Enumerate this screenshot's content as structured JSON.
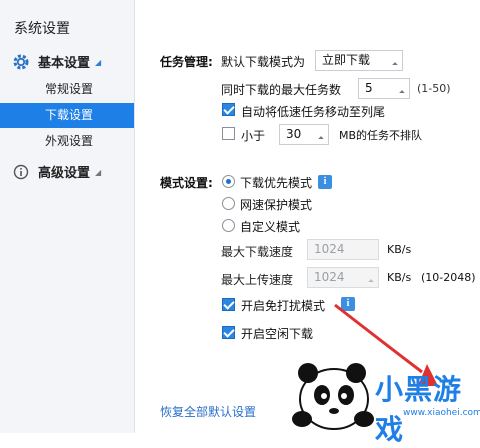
{
  "sidebar": {
    "title": "系统设置",
    "groups": [
      {
        "label": "基本设置",
        "icon": "gear-icon",
        "items": [
          {
            "label": "常规设置"
          },
          {
            "label": "下载设置",
            "active": true
          },
          {
            "label": "外观设置"
          }
        ]
      },
      {
        "label": "高级设置",
        "icon": "info-circle-icon"
      }
    ]
  },
  "task": {
    "section_label": "任务管理:",
    "default_mode_label": "默认下载模式为",
    "default_mode_value": "立即下载",
    "max_tasks_label": "同时下载的最大任务数",
    "max_tasks_value": "5",
    "max_tasks_range": "(1-50)",
    "auto_move_label": "自动将低速任务移动至列尾",
    "auto_move_checked": true,
    "less_than_label": "小于",
    "less_than_value": "30",
    "less_than_suffix": "MB的任务不排队",
    "less_than_checked": false
  },
  "mode": {
    "section_label": "模式设置:",
    "options": [
      {
        "label": "下载优先模式",
        "selected": true
      },
      {
        "label": "网速保护模式",
        "selected": false
      },
      {
        "label": "自定义模式",
        "selected": false
      }
    ],
    "max_download_label": "最大下载速度",
    "max_download_value": "1024",
    "max_download_unit": "KB/s",
    "max_upload_label": "最大上传速度",
    "max_upload_value": "1024",
    "max_upload_unit": "KB/s",
    "max_upload_range": "(10-2048)",
    "no_disturb_label": "开启免打扰模式",
    "no_disturb_checked": true,
    "idle_download_label": "开启空闲下载",
    "idle_download_checked": true
  },
  "restore_label": "恢复全部默认设置",
  "watermark": {
    "main": "小黑游戏",
    "sub": "www.xiaohei.com"
  },
  "colors": {
    "accent": "#1e7fe6",
    "checkbox": "#2a86e0",
    "arrow": "#e03030"
  }
}
